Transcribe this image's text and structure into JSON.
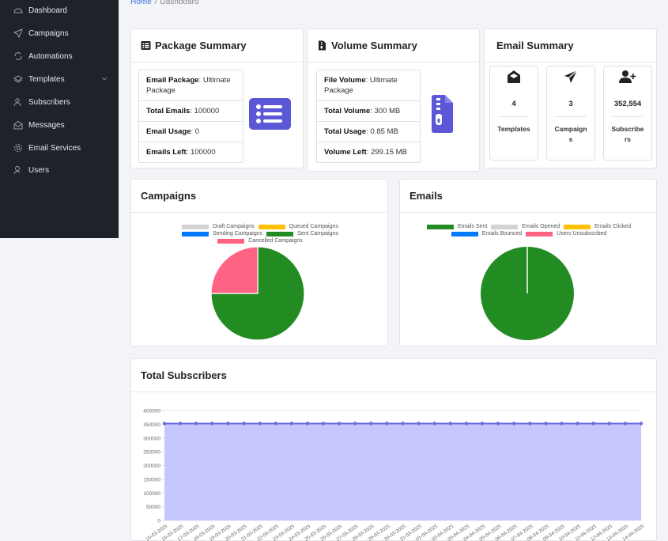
{
  "sidebar": {
    "items": [
      {
        "label": "Dashboard",
        "icon": "dashboard-icon"
      },
      {
        "label": "Campaigns",
        "icon": "send-icon"
      },
      {
        "label": "Automations",
        "icon": "refresh-icon"
      },
      {
        "label": "Templates",
        "icon": "layers-icon"
      },
      {
        "label": "Subscribers",
        "icon": "users-icon"
      },
      {
        "label": "Messages",
        "icon": "mail-icon"
      },
      {
        "label": "Email Services",
        "icon": "gear-icon"
      },
      {
        "label": "Users",
        "icon": "user-icon"
      }
    ]
  },
  "breadcrumb": {
    "home": "Home",
    "separator": "/",
    "current": "Dashboard"
  },
  "package_summary": {
    "title": "Package Summary",
    "rows": [
      {
        "label": "Email Package",
        "value": "Ultimate Package"
      },
      {
        "label": "Total Emails",
        "value": "100000"
      },
      {
        "label": "Email Usage",
        "value": "0"
      },
      {
        "label": "Emails Left",
        "value": "100000"
      }
    ]
  },
  "volume_summary": {
    "title": "Volume Summary",
    "rows": [
      {
        "label": "File Volume",
        "value": "Ultimate Package"
      },
      {
        "label": "Total Volume",
        "value": "300 MB"
      },
      {
        "label": "Total Usage",
        "value": "0.85 MB"
      },
      {
        "label": "Volume Left",
        "value": "299.15 MB"
      }
    ]
  },
  "email_summary": {
    "title": "Email Summary",
    "boxes": [
      {
        "value": "4",
        "label": "Templates",
        "icon": "envelope-open-icon"
      },
      {
        "value": "3",
        "label": "Campaigns",
        "icon": "paper-plane-icon"
      },
      {
        "value": "352,554",
        "label": "Subscribers",
        "icon": "user-plus-icon"
      }
    ]
  },
  "colors": {
    "accent": "#5b57d6",
    "green": "#228b22",
    "pink": "#ff6384",
    "gray": "#d3d3d3",
    "yellow": "#ffc107",
    "blue": "#007bff",
    "area": "#c6c6ff",
    "line": "#6a6ae0"
  },
  "chart_data": [
    {
      "type": "pie",
      "title": "Campaigns",
      "legend_position": "top",
      "labels": [
        "Draft Campaigns",
        "Queued Campaigns",
        "Sending Campaigns",
        "Sent Campaigns",
        "Cancelled Campaigns"
      ],
      "colors": [
        "#d3d3d3",
        "#ffc107",
        "#007bff",
        "#228b22",
        "#ff6384"
      ],
      "values": [
        0,
        0,
        0,
        3,
        1
      ]
    },
    {
      "type": "pie",
      "title": "Emails",
      "legend_position": "top",
      "labels": [
        "Emails Sent",
        "Emails Opened",
        "Emails Clicked",
        "Emails Bounced",
        "Users Unsubscribed"
      ],
      "colors": [
        "#228b22",
        "#d3d3d3",
        "#ffc107",
        "#007bff",
        "#ff6384"
      ],
      "values": [
        1,
        0,
        0,
        0,
        0
      ]
    },
    {
      "type": "area",
      "title": "Total Subscribers",
      "ylim": [
        0,
        400000
      ],
      "yticks": [
        0,
        50000,
        100000,
        150000,
        200000,
        250000,
        300000,
        350000,
        400000
      ],
      "grid": true,
      "x": [
        "15-03-2025",
        "16-03-2025",
        "17-03-2025",
        "18-03-2025",
        "19-03-2025",
        "20-03-2025",
        "21-03-2025",
        "22-03-2025",
        "23-03-2025",
        "24-03-2025",
        "25-03-2025",
        "26-03-2025",
        "27-03-2025",
        "28-03-2025",
        "29-03-2025",
        "30-03-2025",
        "31-03-2025",
        "01-04-2025",
        "02-04-2025",
        "03-04-2025",
        "04-04-2025",
        "05-04-2025",
        "06-04-2025",
        "07-04-2025",
        "08-04-2025",
        "09-04-2025",
        "10-04-2025",
        "11-04-2025",
        "12-04-2025",
        "13-04-2025",
        "14-04-2025"
      ],
      "y": [
        352554,
        352554,
        352554,
        352554,
        352554,
        352554,
        352554,
        352554,
        352554,
        352554,
        352554,
        352554,
        352554,
        352554,
        352554,
        352554,
        352554,
        352554,
        352554,
        352554,
        352554,
        352554,
        352554,
        352554,
        352554,
        352554,
        352554,
        352554,
        352554,
        352554,
        352554
      ]
    }
  ]
}
